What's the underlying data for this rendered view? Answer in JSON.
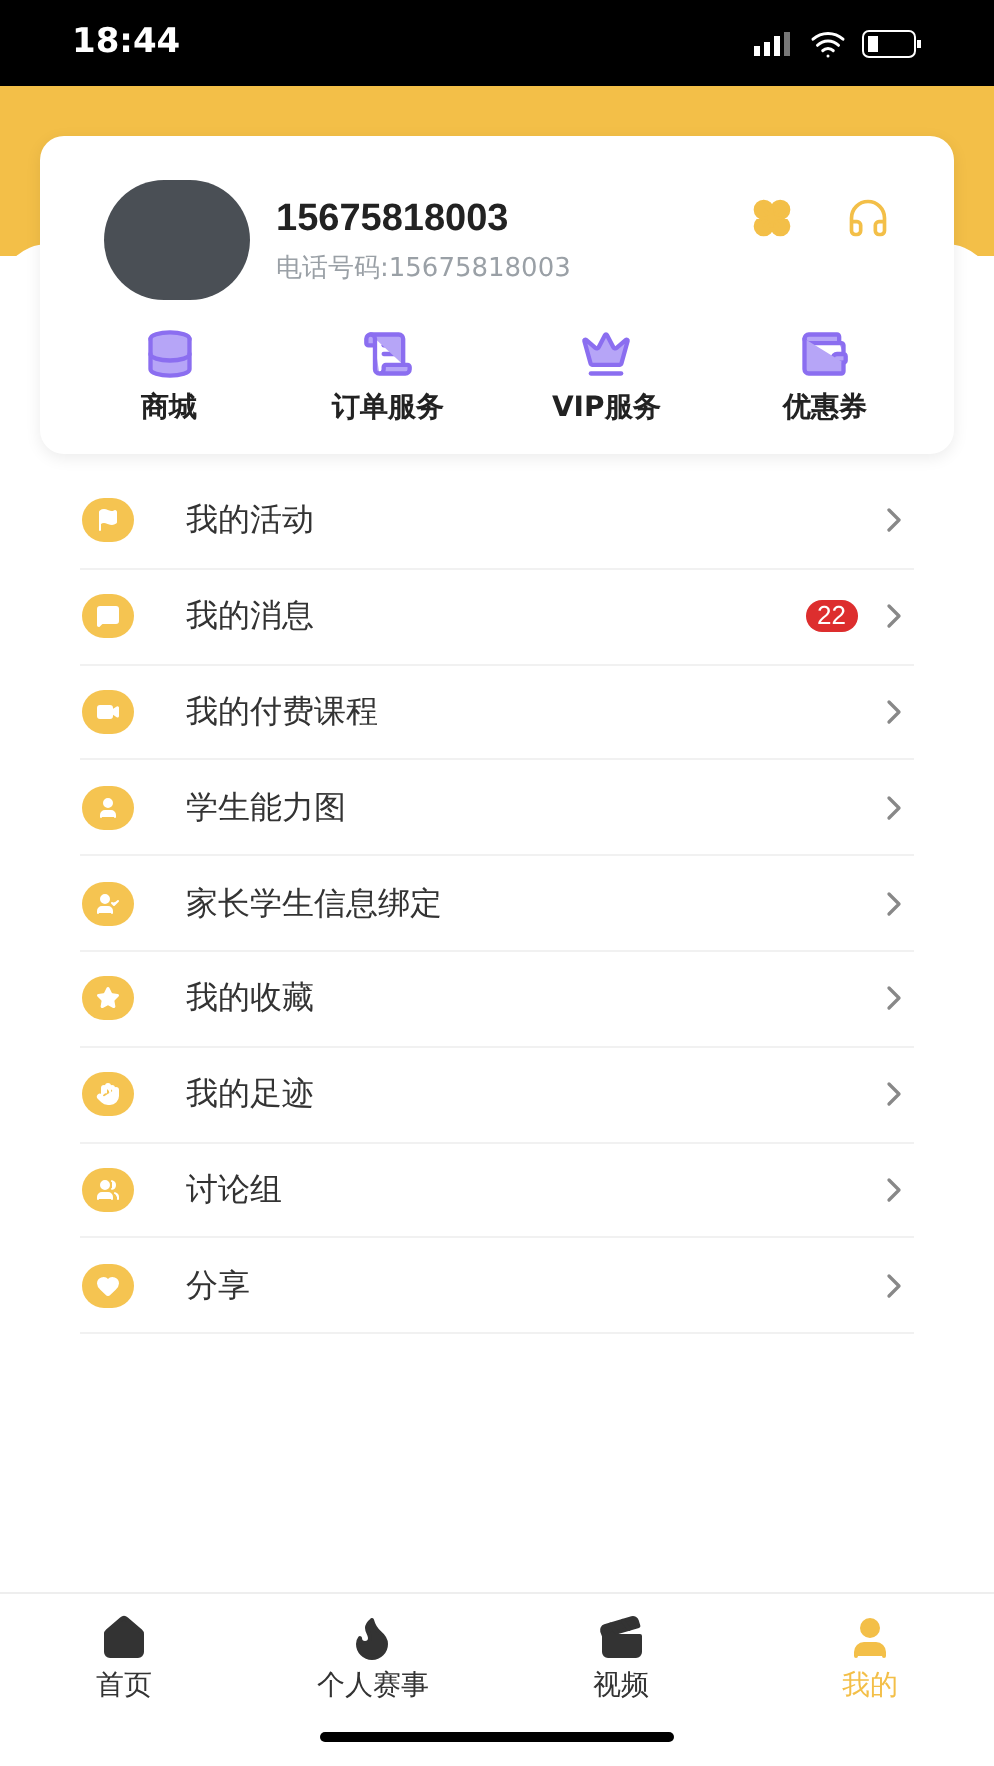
{
  "status_bar": {
    "time": "18:44"
  },
  "profile": {
    "name": "15675818003",
    "phone": "电话号码:15675818003"
  },
  "shortcuts": [
    {
      "kind": "store",
      "label": "商城"
    },
    {
      "kind": "order",
      "label": "订单服务"
    },
    {
      "kind": "vip",
      "label": "VIP服务"
    },
    {
      "kind": "coupon",
      "label": "优惠券"
    }
  ],
  "menu": [
    {
      "kind": "flag",
      "label": "我的活动"
    },
    {
      "kind": "message",
      "label": "我的消息",
      "badge": "22"
    },
    {
      "kind": "video",
      "label": "我的付费课程"
    },
    {
      "kind": "person",
      "label": "学生能力图"
    },
    {
      "kind": "bind",
      "label": "家长学生信息绑定"
    },
    {
      "kind": "star",
      "label": "我的收藏"
    },
    {
      "kind": "foot",
      "label": "我的足迹"
    },
    {
      "kind": "group",
      "label": "讨论组"
    },
    {
      "kind": "heart",
      "label": "分享"
    }
  ],
  "tab_bar": [
    {
      "kind": "home",
      "label": "首页",
      "selected": false
    },
    {
      "kind": "fire",
      "label": "个人赛事",
      "selected": false
    },
    {
      "kind": "video",
      "label": "视频",
      "selected": false
    },
    {
      "kind": "me",
      "label": "我的",
      "selected": true
    }
  ]
}
